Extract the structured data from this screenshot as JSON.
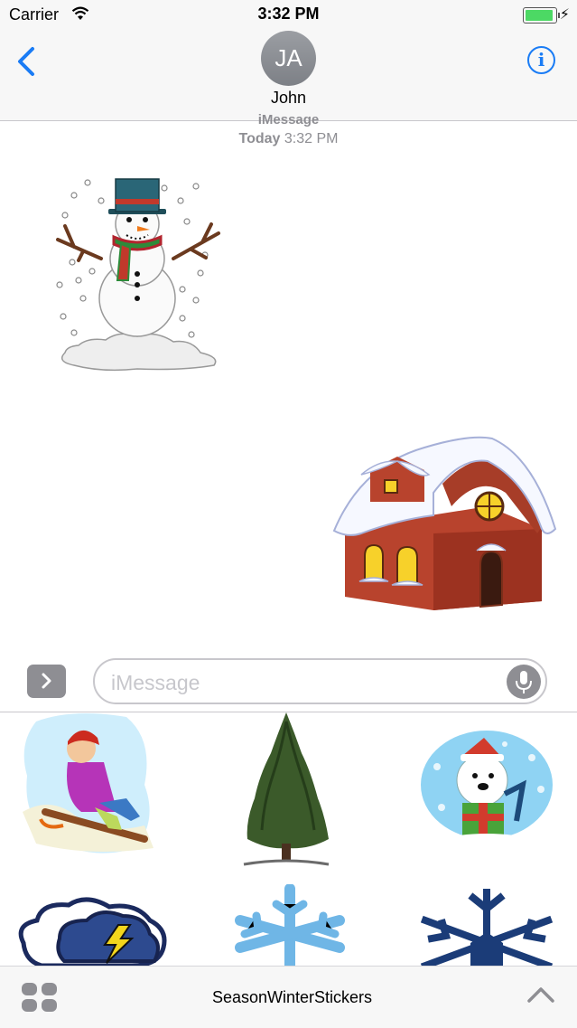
{
  "status": {
    "carrier": "Carrier",
    "time": "3:32 PM"
  },
  "nav": {
    "avatar_initials": "JA",
    "contact_name": "John"
  },
  "thread": {
    "service_label": "iMessage",
    "day": "Today",
    "time": "3:32 PM"
  },
  "compose": {
    "placeholder": "iMessage"
  },
  "bottom_bar": {
    "pack_name": "SeasonWinterStickers"
  },
  "colors": {
    "accent": "#1a7cf5",
    "gray": "#8e8e93",
    "battery": "#4cd964"
  },
  "icons": [
    "back-chevron-icon",
    "info-icon",
    "wifi-icon",
    "battery-icon",
    "microphone-icon",
    "chevron-right-icon",
    "app-grid-icon",
    "chevron-up-icon"
  ],
  "stickers": {
    "messages": [
      "snowman",
      "snowy-house"
    ],
    "drawer": [
      "child-sledding",
      "pine-tree",
      "polar-bear-present",
      "storm-cloud-lightning",
      "light-blue-snowflake",
      "navy-snowflake"
    ]
  }
}
